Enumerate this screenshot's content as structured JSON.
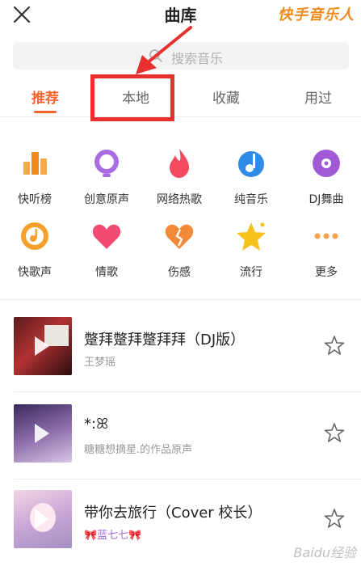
{
  "header": {
    "title": "曲库",
    "brand": "快手音乐人"
  },
  "search": {
    "placeholder": "搜索音乐"
  },
  "tabs": [
    {
      "label": "推荐",
      "active": true
    },
    {
      "label": "本地",
      "active": false
    },
    {
      "label": "收藏",
      "active": false
    },
    {
      "label": "用过",
      "active": false
    }
  ],
  "categories": [
    {
      "label": "快听榜",
      "icon": "chart-bars-icon"
    },
    {
      "label": "创意原声",
      "icon": "microphone-icon"
    },
    {
      "label": "网络热歌",
      "icon": "flame-icon"
    },
    {
      "label": "纯音乐",
      "icon": "music-note-icon"
    },
    {
      "label": "DJ舞曲",
      "icon": "vinyl-disc-icon"
    },
    {
      "label": "快歌声",
      "icon": "music-circle-icon"
    },
    {
      "label": "情歌",
      "icon": "heart-icon"
    },
    {
      "label": "伤感",
      "icon": "broken-heart-icon"
    },
    {
      "label": "流行",
      "icon": "star-icon"
    },
    {
      "label": "更多",
      "icon": "more-dots-icon"
    }
  ],
  "songs": [
    {
      "title": "蹩拜蹩拜蹩拜拜（DJ版）",
      "artist": "王梦瑶"
    },
    {
      "title": "*:ꕤ",
      "artist": "糖糖想摘星.的作品原声"
    },
    {
      "title": "带你去旅行（Cover 校长）",
      "artist": "🎀蓝七七🎀"
    }
  ],
  "watermark": "Baidu经验",
  "colors": {
    "accent": "#f2662f",
    "annotation": "#e8312f",
    "brand": "#f08a1c"
  }
}
